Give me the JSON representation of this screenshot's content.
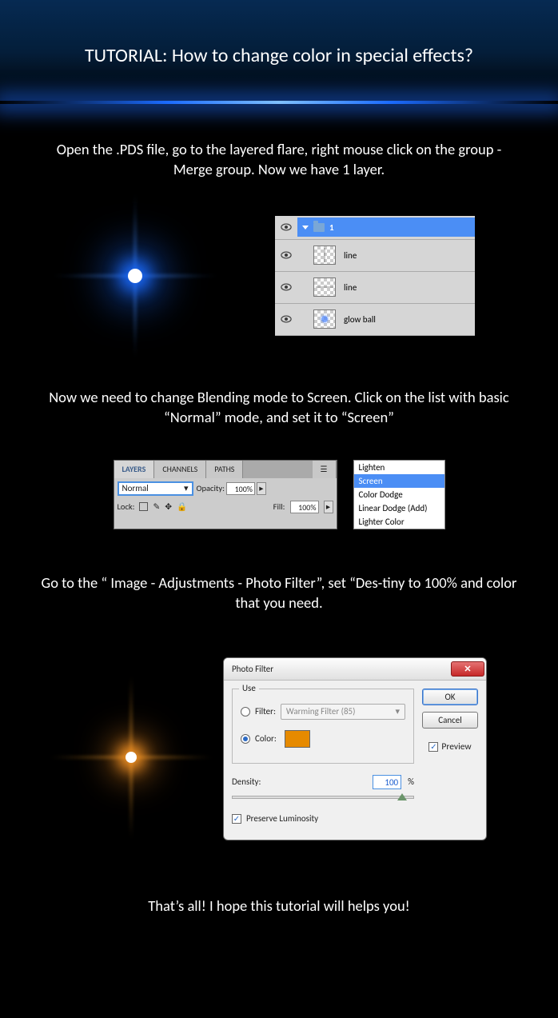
{
  "title": "TUTORIAL: How to change color in special effects?",
  "step1": {
    "text": "Open the .PDS file, go to the layered flare, right mouse click on the group - Merge group. Now we have 1 layer.",
    "panel": {
      "group_name": "1",
      "layers": [
        {
          "name": "line",
          "thumb": "vline"
        },
        {
          "name": "line",
          "thumb": "hline"
        },
        {
          "name": "glow ball",
          "thumb": "glow"
        }
      ]
    }
  },
  "step2": {
    "text": "Now we need to change Blending mode to Screen. Click on the list with basic “Normal” mode, and set it to “Screen”",
    "panel": {
      "tabs": [
        "LAYERS",
        "CHANNELS",
        "PATHS"
      ],
      "mode": "Normal",
      "opacity_label": "Opacity:",
      "opacity_value": "100%",
      "lock_label": "Lock:",
      "fill_label": "Fill:",
      "fill_value": "100%"
    },
    "dropdown": {
      "options": [
        "Lighten",
        "Screen",
        "Color Dodge",
        "Linear Dodge (Add)",
        "Lighter Color"
      ],
      "selected": "Screen"
    }
  },
  "step3": {
    "text": "Go to the “ Image - Adjustments - Photo Filter”, set “Des-tiny to 100% and color that you need.",
    "dialog": {
      "title": "Photo Filter",
      "use_label": "Use",
      "filter_label": "Filter:",
      "filter_value": "Warming Filter (85)",
      "color_label": "Color:",
      "color_hex": "#e68a00",
      "density_label": "Density:",
      "density_value": "100",
      "density_unit": "%",
      "preserve_label": "Preserve Luminosity",
      "ok": "OK",
      "cancel": "Cancel",
      "preview": "Preview"
    }
  },
  "footer": "That’s all! I hope this tutorial will helps you!"
}
